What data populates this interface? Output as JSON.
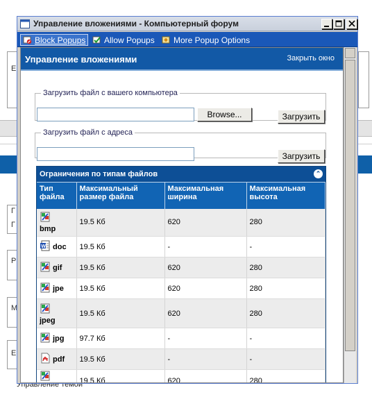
{
  "window": {
    "title": "Управление вложениями - Компьютерный форум"
  },
  "popup_toolbar": {
    "block_label": "Block Popups",
    "allow_label": "Allow Popups",
    "more_label": "More Popup Options"
  },
  "panel": {
    "title": "Управление вложениями",
    "close_link": "Закрыть окно"
  },
  "upload_computer": {
    "legend": "Загрузить файл с вашего компьютера",
    "browse_label": "Browse...",
    "upload_label": "Загрузить"
  },
  "upload_url": {
    "legend": "Загрузить файл с адреса",
    "upload_label": "Загрузить"
  },
  "limits": {
    "title": "Ограничения по типам файлов",
    "columns": [
      "Тип файла",
      "Максимальный размер файла",
      "Максимальная ширина",
      "Максимальная высота"
    ],
    "rows": [
      {
        "ext": "bmp",
        "icon": "image-file-icon",
        "size": "19.5 Кб",
        "width": "620",
        "height": "280"
      },
      {
        "ext": "doc",
        "icon": "word-doc-icon",
        "size": "19.5 Кб",
        "width": "-",
        "height": "-"
      },
      {
        "ext": "gif",
        "icon": "image-file-icon",
        "size": "19.5 Кб",
        "width": "620",
        "height": "280"
      },
      {
        "ext": "jpe",
        "icon": "image-file-icon",
        "size": "19.5 Кб",
        "width": "620",
        "height": "280"
      },
      {
        "ext": "jpeg",
        "icon": "image-file-icon",
        "size": "19.5 Кб",
        "width": "620",
        "height": "280"
      },
      {
        "ext": "jpg",
        "icon": "image-file-icon",
        "size": "97.7 Кб",
        "width": "-",
        "height": "-"
      },
      {
        "ext": "pdf",
        "icon": "pdf-file-icon",
        "size": "19.5 Кб",
        "width": "-",
        "height": "-"
      },
      {
        "ext": "png",
        "icon": "image-file-icon",
        "size": "19.5 Кб",
        "width": "620",
        "height": "280"
      }
    ]
  },
  "background_page": {
    "footer_text": "Управление темой"
  },
  "colors": {
    "panel_header": "#1259a6",
    "table_header": "#1164b4",
    "popup_bar": "#1a58b8"
  }
}
